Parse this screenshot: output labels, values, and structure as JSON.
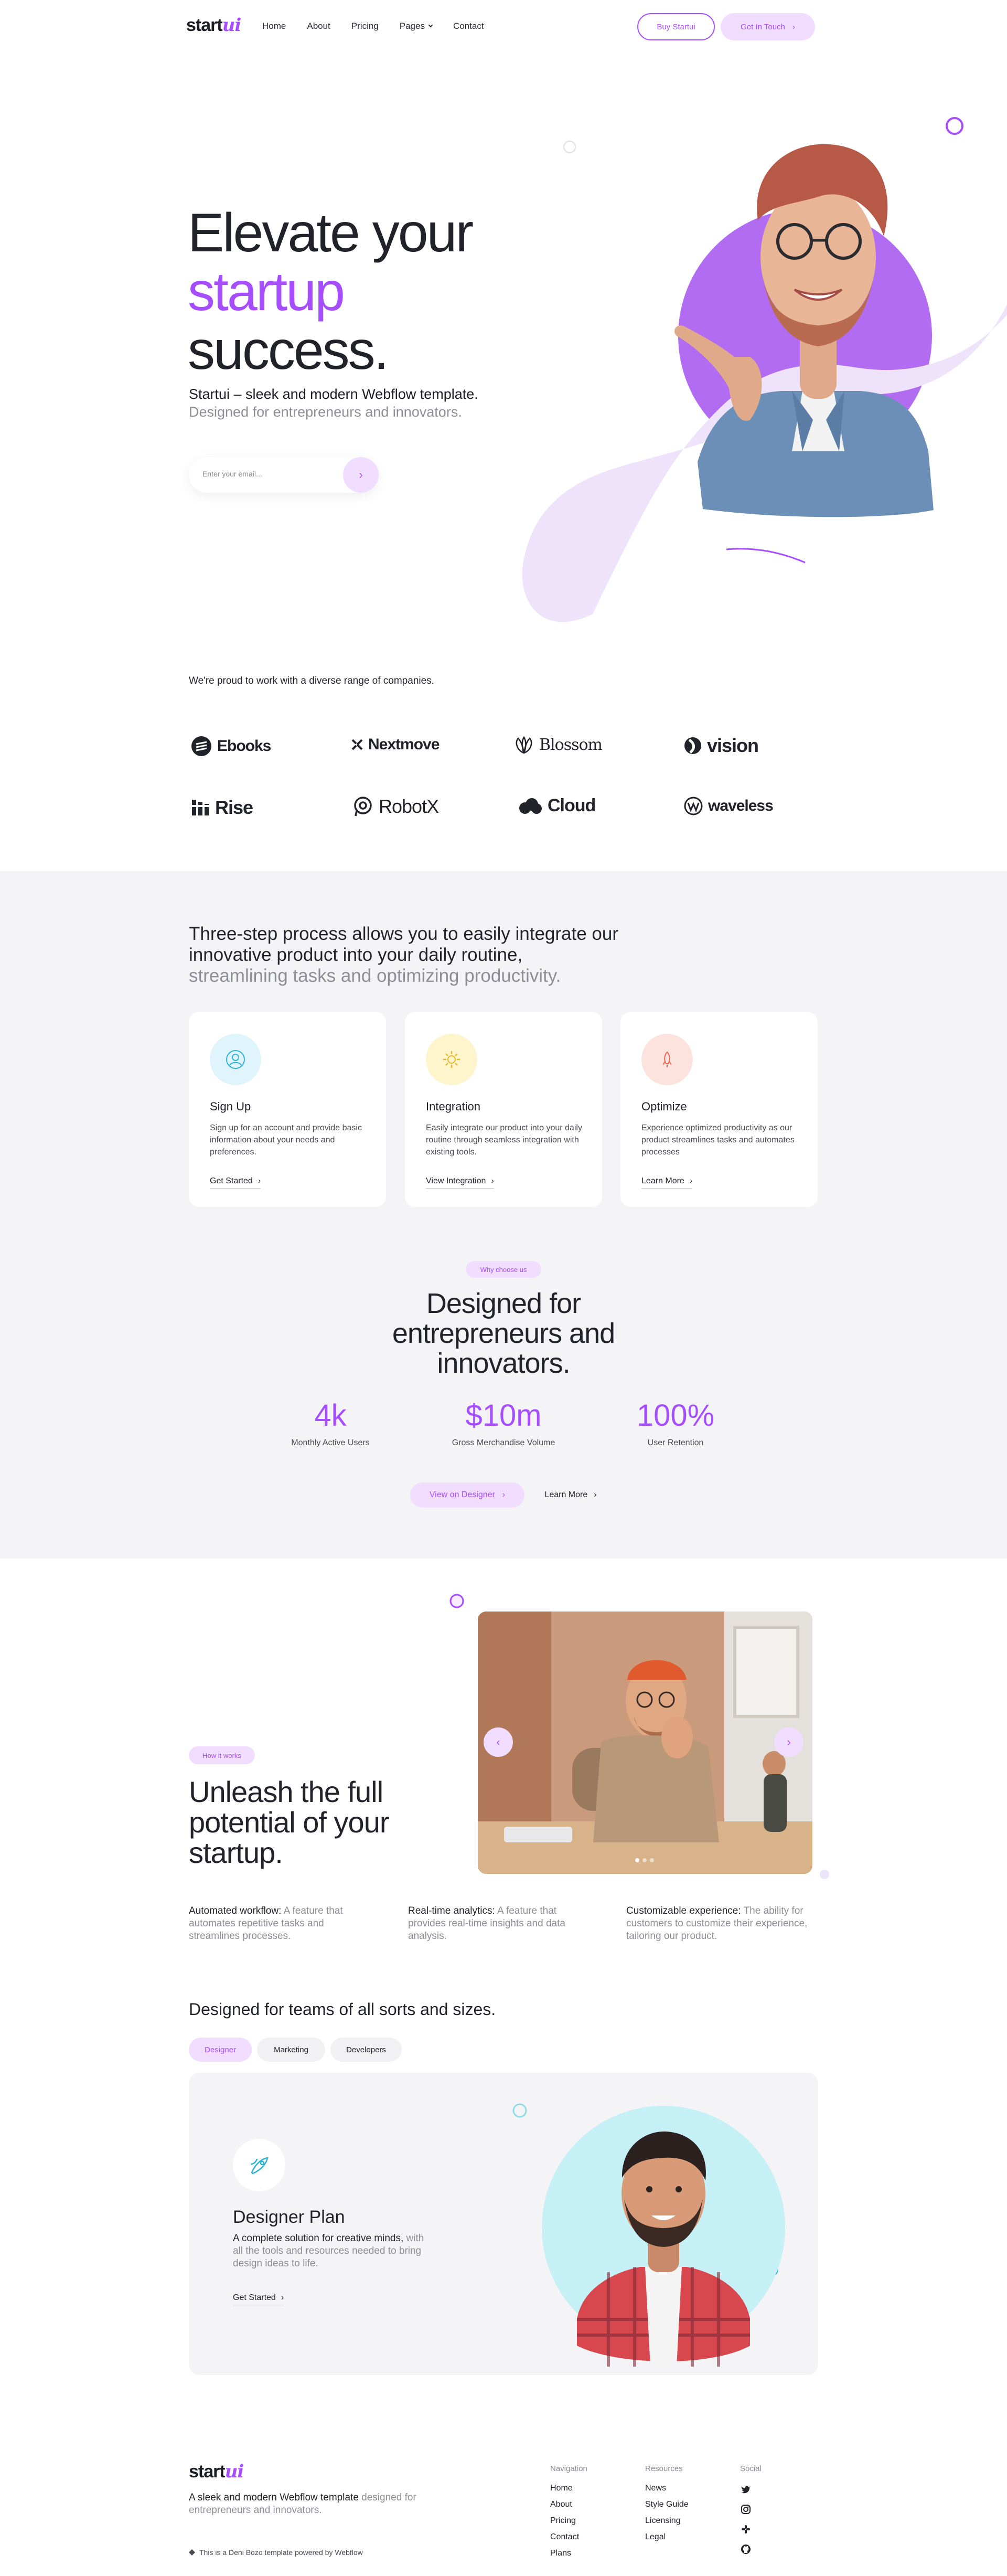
{
  "brand": {
    "name": "start",
    "accent_suffix": "ui",
    "accent_color": "#a64dff",
    "accent_light": "#f1ddff"
  },
  "nav": {
    "links": [
      "Home",
      "About",
      "Pricing",
      "Pages",
      "Contact"
    ],
    "buy_label": "Buy Startui",
    "touch_label": "Get In Touch"
  },
  "hero": {
    "title_line1": "Elevate your",
    "title_highlight": "startup",
    "title_line3": "success.",
    "subtitle_bold": "Startui – sleek and modern Webflow template.",
    "subtitle_muted": "Designed for entrepreneurs and innovators.",
    "email_placeholder": "Enter your email..."
  },
  "companies": {
    "intro": "We're proud to work with a diverse range of companies.",
    "logos": [
      "Ebooks",
      "Nextmove",
      "Blossom",
      "vision",
      "Rise",
      "RobotX",
      "Cloud",
      "waveless"
    ]
  },
  "process": {
    "title_bold": "Three-step process allows you to easily integrate our innovative product into your daily routine,",
    "title_muted": "streamlining tasks and optimizing productivity.",
    "cards": [
      {
        "title": "Sign Up",
        "desc": "Sign up for an account and provide basic information about your needs and preferences.",
        "link": "Get Started",
        "icon": "user-icon"
      },
      {
        "title": "Integration",
        "desc": "Easily integrate our product into your daily routine through seamless integration with existing tools.",
        "link": "View Integration",
        "icon": "gear-icon"
      },
      {
        "title": "Optimize",
        "desc": "Experience optimized productivity as our product streamlines tasks and automates processes",
        "link": "Learn More",
        "icon": "rocket-icon"
      }
    ]
  },
  "why": {
    "pill": "Why choose us",
    "title": "Designed for entrepreneurs and innovators.",
    "stats": [
      {
        "value": "4k",
        "label": "Monthly Active Users"
      },
      {
        "value": "$10m",
        "label": "Gross Merchandise Volume"
      },
      {
        "value": "100%",
        "label": "User Retention"
      }
    ],
    "view_label": "View on Designer",
    "learn_label": "Learn More"
  },
  "how": {
    "pill": "How it works",
    "title": "Unleash the full potential of your startup.",
    "features": [
      {
        "bold": "Automated workflow:",
        "muted": "A feature that automates repetitive tasks and streamlines processes."
      },
      {
        "bold": "Real-time analytics:",
        "muted": "A feature that provides real-time insights and data analysis."
      },
      {
        "bold": "Customizable experience:",
        "muted": "The ability for customers to customize their experience, tailoring our product."
      }
    ]
  },
  "teams": {
    "title": "Designed for teams of all sorts and sizes.",
    "tabs": [
      "Designer",
      "Marketing",
      "Developers"
    ],
    "plan_title": "Designer Plan",
    "plan_desc_bold": "A complete solution for creative minds,",
    "plan_desc_muted": "with all the tools and resources needed to bring design ideas to life.",
    "plan_link": "Get Started"
  },
  "footer": {
    "desc_bold": "A sleek and modern Webflow template",
    "desc_muted": "designed for entrepreneurs and innovators.",
    "credit": "This is a Deni Bozo template powered by Webflow",
    "nav_heading": "Navigation",
    "nav_items": [
      "Home",
      "About",
      "Pricing",
      "Contact",
      "Plans"
    ],
    "res_heading": "Resources",
    "res_items": [
      "News",
      "Style Guide",
      "Licensing",
      "Legal"
    ],
    "social_heading": "Social"
  }
}
